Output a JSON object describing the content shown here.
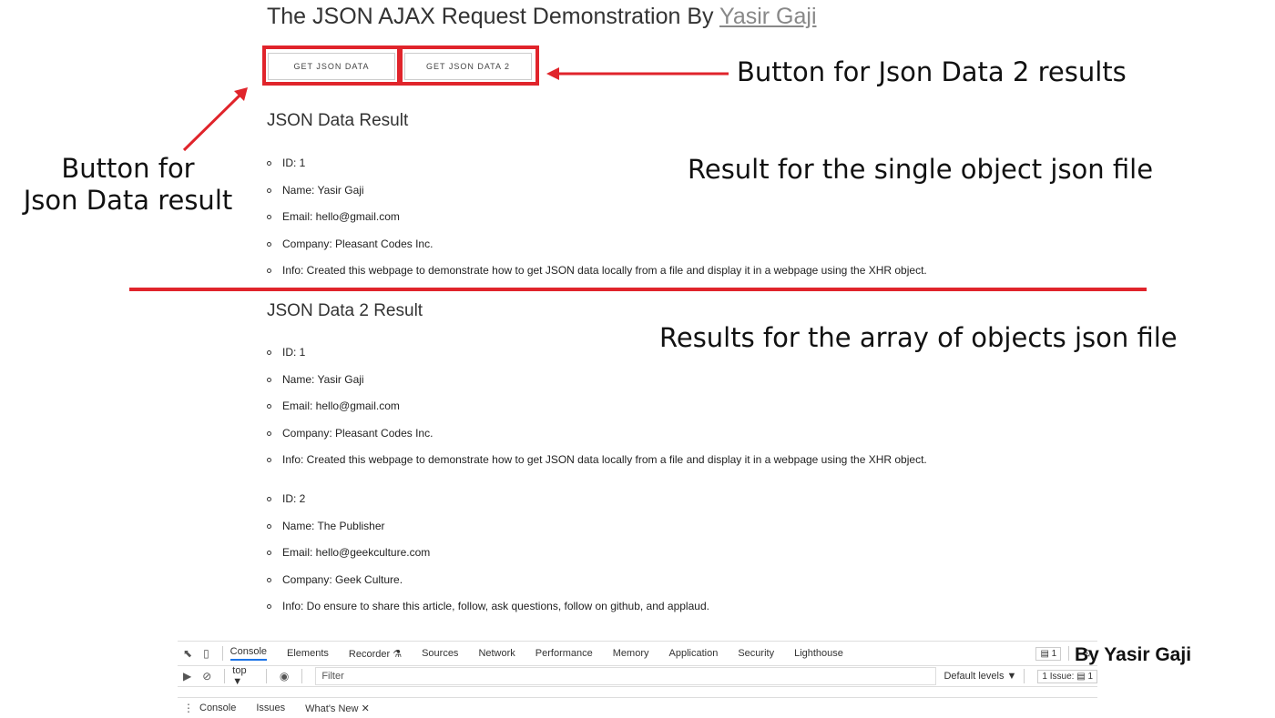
{
  "page": {
    "title_prefix": "The JSON AJAX Request Demonstration By ",
    "title_link": "Yasir Gaji"
  },
  "buttons": {
    "get_json_data": "GET JSON DATA",
    "get_json_data_2": "GET JSON DATA 2"
  },
  "section1": {
    "heading": "JSON Data Result",
    "items": [
      "ID: 1",
      "Name: Yasir Gaji",
      "Email: hello@gmail.com",
      "Company: Pleasant Codes Inc.",
      "Info: Created this webpage to demonstrate how to get JSON data locally from a file and display it in a webpage using the XHR object."
    ]
  },
  "section2": {
    "heading": "JSON Data 2 Result",
    "group1": [
      "ID: 1",
      "Name: Yasir Gaji",
      "Email: hello@gmail.com",
      "Company: Pleasant Codes Inc.",
      "Info: Created this webpage to demonstrate how to get JSON data locally from a file and display it in a webpage using the XHR object."
    ],
    "group2": [
      "ID: 2",
      "Name: The Publisher",
      "Email: hello@geekculture.com",
      "Company: Geek Culture.",
      "Info: Do ensure to share this article, follow, ask questions, follow on github, and applaud."
    ]
  },
  "annotations": {
    "button2": "Button for Json Data 2 results",
    "button1_line1": "Button for",
    "button1_line2": "Json Data result",
    "single_result": "Result for the single object json file",
    "array_result": "Results for the array of objects json file"
  },
  "colors": {
    "annotation_red": "#e0242b",
    "link_gray": "#888888"
  },
  "devtools": {
    "tabs": [
      "Console",
      "Elements",
      "Recorder",
      "Sources",
      "Network",
      "Performance",
      "Memory",
      "Application",
      "Security",
      "Lighthouse"
    ],
    "issues_count": "1",
    "context": "top",
    "filter_placeholder": "Filter",
    "levels": "Default levels",
    "issue_badge": "1 Issue:",
    "issue_badge_count": "1",
    "drawer_tabs": [
      "Console",
      "Issues",
      "What's New"
    ]
  },
  "byline": "By Yasir Gaji"
}
